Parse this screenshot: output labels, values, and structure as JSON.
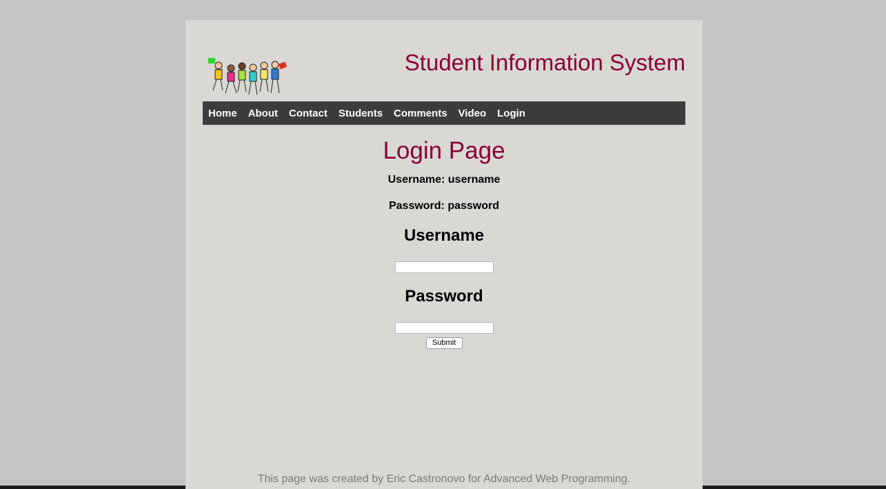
{
  "header": {
    "site_title": "Student Information System",
    "logo_icon": "jumping-students-logo"
  },
  "nav": {
    "items": [
      {
        "label": "Home"
      },
      {
        "label": "About"
      },
      {
        "label": "Contact"
      },
      {
        "label": "Students"
      },
      {
        "label": "Comments"
      },
      {
        "label": "Video"
      },
      {
        "label": "Login"
      }
    ]
  },
  "login": {
    "title": "Login Page",
    "hint_username": "Username: username",
    "hint_password": "Password: password",
    "username_heading": "Username",
    "username_value": "",
    "password_heading": "Password",
    "password_value": "",
    "submit_label": "Submit"
  },
  "footer": {
    "text": "This page was created by Eric Castronovo for Advanced Web Programming."
  },
  "colors": {
    "accent": "#8a0035",
    "nav_background": "#3c3c3c",
    "page_background": "#d9d8d4",
    "outer_background": "#c4c4c4"
  }
}
